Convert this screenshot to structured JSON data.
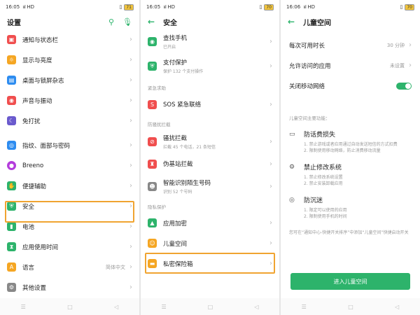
{
  "colors": {
    "accent": "#2db36b",
    "highlight": "#f0a431"
  },
  "p1": {
    "status": {
      "time": "16:05",
      "net": "HD",
      "battery": "71"
    },
    "title": "设置",
    "items_a": [
      {
        "label": "通知与状态栏",
        "icon": "bell-icon",
        "color": "#f04e4e"
      },
      {
        "label": "显示与亮度",
        "icon": "sun-icon",
        "color": "#f5a623"
      },
      {
        "label": "桌面与锁屏杂志",
        "icon": "picture-icon",
        "color": "#2d8cf0"
      },
      {
        "label": "声音与振动",
        "icon": "speaker-icon",
        "color": "#f04e4e"
      },
      {
        "label": "免打扰",
        "icon": "moon-icon",
        "color": "#6a5acd"
      }
    ],
    "items_b": [
      {
        "label": "指纹、面部与密码",
        "icon": "fingerprint-icon",
        "color": "#2d8cf0"
      },
      {
        "label": "Breeno",
        "icon": "breeno-icon",
        "color": "#b43cdc"
      },
      {
        "label": "便捷辅助",
        "icon": "hand-icon",
        "color": "#2db36b"
      },
      {
        "label": "安全",
        "icon": "shield-icon",
        "color": "#2db36b"
      },
      {
        "label": "电池",
        "icon": "battery-icon",
        "color": "#2db36b"
      },
      {
        "label": "应用使用时间",
        "icon": "hourglass-icon",
        "color": "#2db36b"
      },
      {
        "label": "语言",
        "icon": "language-icon",
        "color": "#f5a623",
        "value": "简体中文"
      },
      {
        "label": "其他设置",
        "icon": "gear-icon",
        "color": "#888888"
      }
    ]
  },
  "p2": {
    "status": {
      "time": "16:05",
      "net": "HD",
      "battery": "70"
    },
    "title": "安全",
    "top": [
      {
        "label": "查找手机",
        "sub": "已开启",
        "icon": "locate-icon",
        "color": "#2db36b"
      },
      {
        "label": "支付保护",
        "sub": "保护 132 个支付操作",
        "icon": "payshield-icon",
        "color": "#2db36b"
      }
    ],
    "group1": "紧急求助",
    "sos": {
      "label": "SOS 紧急联络",
      "icon": "sos-icon",
      "color": "#f04e4e"
    },
    "group2": "防骚扰拦截",
    "block": [
      {
        "label": "骚扰拦截",
        "sub": "拦截 45 个电话，21 条短信",
        "icon": "block-icon",
        "color": "#f04e4e"
      },
      {
        "label": "伪基站拦截",
        "icon": "antenna-icon",
        "color": "#f04e4e"
      },
      {
        "label": "智能识别陌生号码",
        "sub": "识别 52 个号码",
        "icon": "person-icon",
        "color": "#888888"
      }
    ],
    "group3": "隐私保护",
    "privacy": [
      {
        "label": "应用加密",
        "icon": "lock-icon",
        "color": "#2db36b"
      },
      {
        "label": "儿童空间",
        "icon": "child-icon",
        "color": "#f5a623"
      },
      {
        "label": "私密保险箱",
        "icon": "folder-icon",
        "color": "#f5a623"
      }
    ]
  },
  "p3": {
    "status": {
      "time": "16:06",
      "net": "HD",
      "battery": "70"
    },
    "title": "儿童空间",
    "rows": [
      {
        "label": "每次可用时长",
        "value": "30 分钟"
      },
      {
        "label": "允许访问的应用",
        "value": "未设置"
      }
    ],
    "toggle_label": "关闭移动网络",
    "intro": "儿童空间主要功能：",
    "features": [
      {
        "title": "防话费损失",
        "icon": "phone-bill-icon",
        "desc": [
          "1. 禁止游戏或者应用通过自动发送短信的方式扣费",
          "2. 限制使用移动网络，防止消费移动流量"
        ]
      },
      {
        "title": "禁止修改系统",
        "icon": "settings-lock-icon",
        "desc": [
          "1. 禁止修改系统设置",
          "2. 禁止安装卸载应用"
        ]
      },
      {
        "title": "防沉迷",
        "icon": "eye-icon",
        "desc": [
          "1. 限定可以使用的应用",
          "2. 限制使用手机的时间"
        ]
      }
    ],
    "footnote": "您可在“通知中心-快捷开关排序”中添加“儿童空间”快捷启动开关",
    "button": "进入儿童空间"
  }
}
